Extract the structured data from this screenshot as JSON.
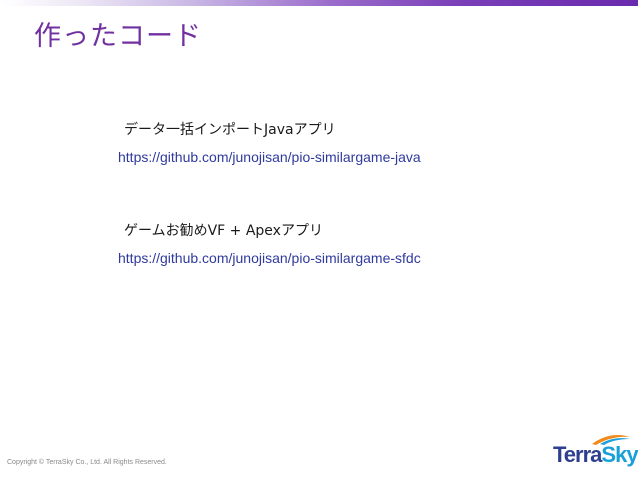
{
  "slide": {
    "title": "作ったコード",
    "items": [
      {
        "label": "データ一括インポートJavaアプリ",
        "link": "https://github.com/junojisan/pio-similargame-java"
      },
      {
        "label": "ゲームお勧めVF + Apexアプリ",
        "link": "https://github.com/junojisan/pio-similargame-sfdc"
      }
    ],
    "footer": {
      "copyright": "Copyright © TerraSky Co., Ltd. All Rights Reserved."
    },
    "logo": {
      "part1": "Terra",
      "part2": "Sky",
      "colors": {
        "terra": "#2e3f8f",
        "sky": "#1aa0d8",
        "swoosh": "#f08a1c"
      }
    }
  },
  "colors": {
    "title": "#7030a0",
    "link": "#2f3a9e",
    "accent_bar": "#6a2aad"
  }
}
